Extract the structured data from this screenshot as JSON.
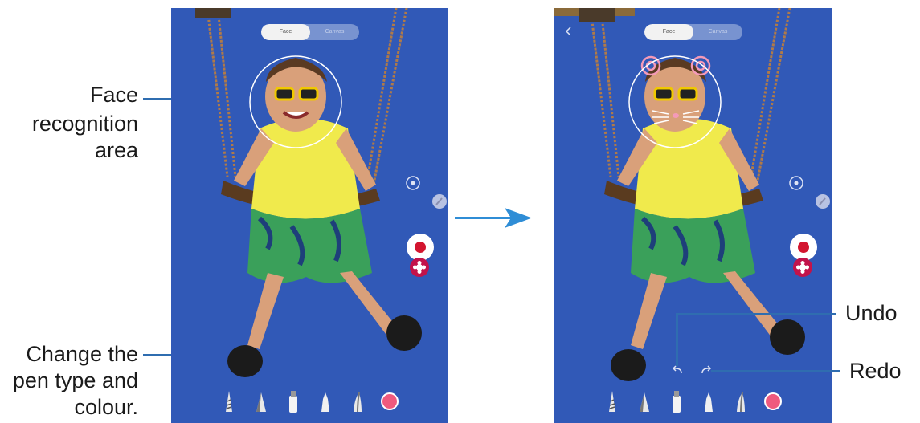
{
  "callouts": {
    "face_line1": "Face",
    "face_line2": "recognition",
    "face_line3": "area",
    "pen_line1": "Change the",
    "pen_line2": "pen type and",
    "pen_line3": "colour.",
    "undo": "Undo",
    "redo": "Redo"
  },
  "screens": {
    "left": {
      "tabs": [
        {
          "label": "Face"
        },
        {
          "label": "Canvas"
        }
      ]
    },
    "right": {
      "tabs": [
        {
          "label": "Face"
        },
        {
          "label": "Canvas"
        }
      ]
    }
  },
  "pen_tools": [
    "pattern-pen-icon",
    "marker-pen-icon",
    "highlighter-pen-icon",
    "fountain-pen-icon",
    "brush-pen-icon",
    "color-swatch-icon"
  ],
  "colors": {
    "accent_line": "#2f6db0",
    "screen_background": "#3159b7",
    "record": "#d3152f",
    "sticker_button": "#c2134a",
    "pen_color": "#ef5a7e",
    "arrow": "#2f8dd6"
  },
  "icons": {
    "arrow": "right-arrow-icon",
    "undo": "undo-icon",
    "redo": "redo-icon",
    "record": "record-icon",
    "switch_camera": "switch-camera-icon",
    "sticker": "sticker-icon",
    "back": "back-icon"
  }
}
